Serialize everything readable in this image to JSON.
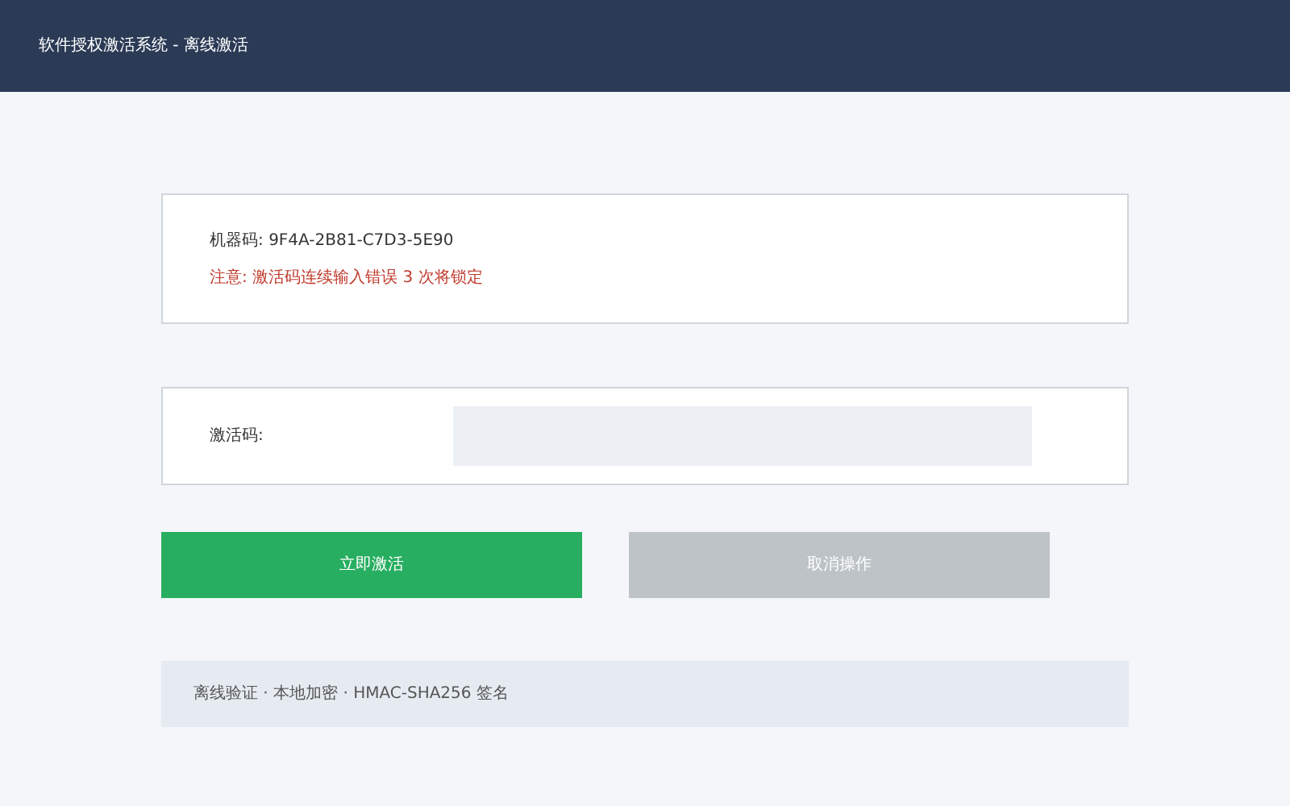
{
  "header": {
    "title": "软件授权激活系统 - 离线激活"
  },
  "info": {
    "machine_code_label": "机器码:",
    "machine_code": "9F4A-2B81-C7D3-5E90",
    "warning": "注意: 激活码连续输入错误 3 次将锁定"
  },
  "activation": {
    "label": "激活码:"
  },
  "buttons": [
    {
      "label": "立即激活",
      "kind": "primary"
    },
    {
      "label": "取消操作",
      "kind": "secondary"
    }
  ],
  "footer": "离线验证 · 本地加密 · HMAC-SHA256 签名"
}
